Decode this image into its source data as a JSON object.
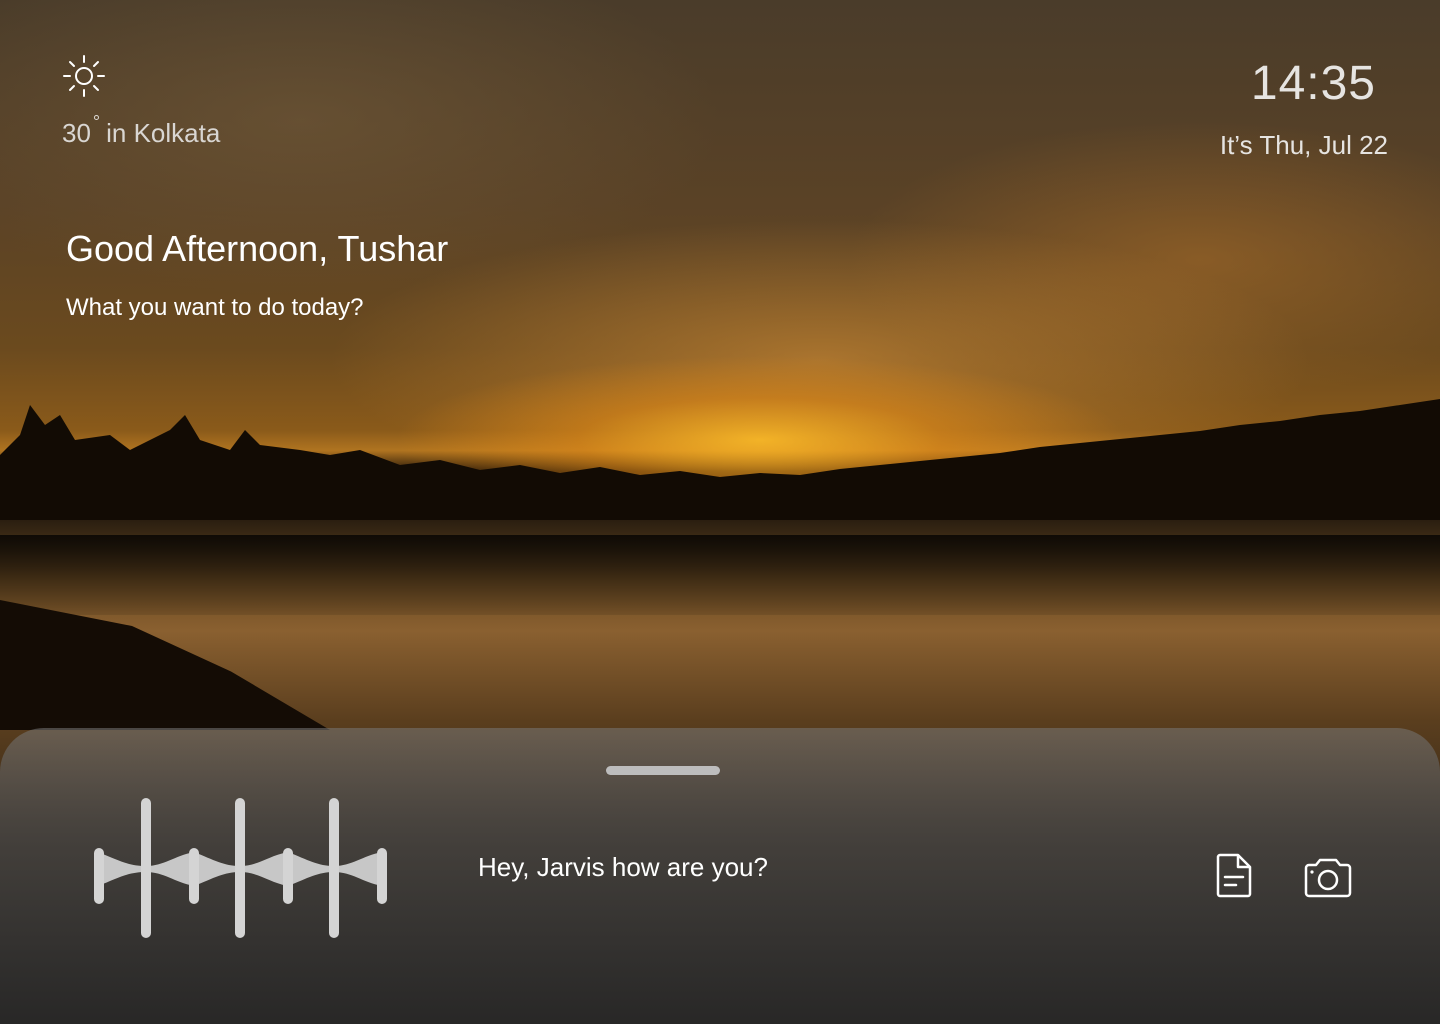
{
  "weather": {
    "icon": "sun-icon",
    "temperature": "30",
    "degree_symbol": "°",
    "location": "in Kolkata"
  },
  "clock": {
    "time": "14:35",
    "date": "It’s Thu, Jul 22"
  },
  "greeting": {
    "title": "Good Afternoon, Tushar",
    "subtitle": "What you want to do today?"
  },
  "assistant": {
    "prompt": "Hey, Jarvis how are you?",
    "icons": [
      "waveform-icon",
      "document-icon",
      "camera-icon"
    ]
  },
  "colors": {
    "sheet": "#464646",
    "handle": "#bdbdbd",
    "text": "#ffffff"
  }
}
